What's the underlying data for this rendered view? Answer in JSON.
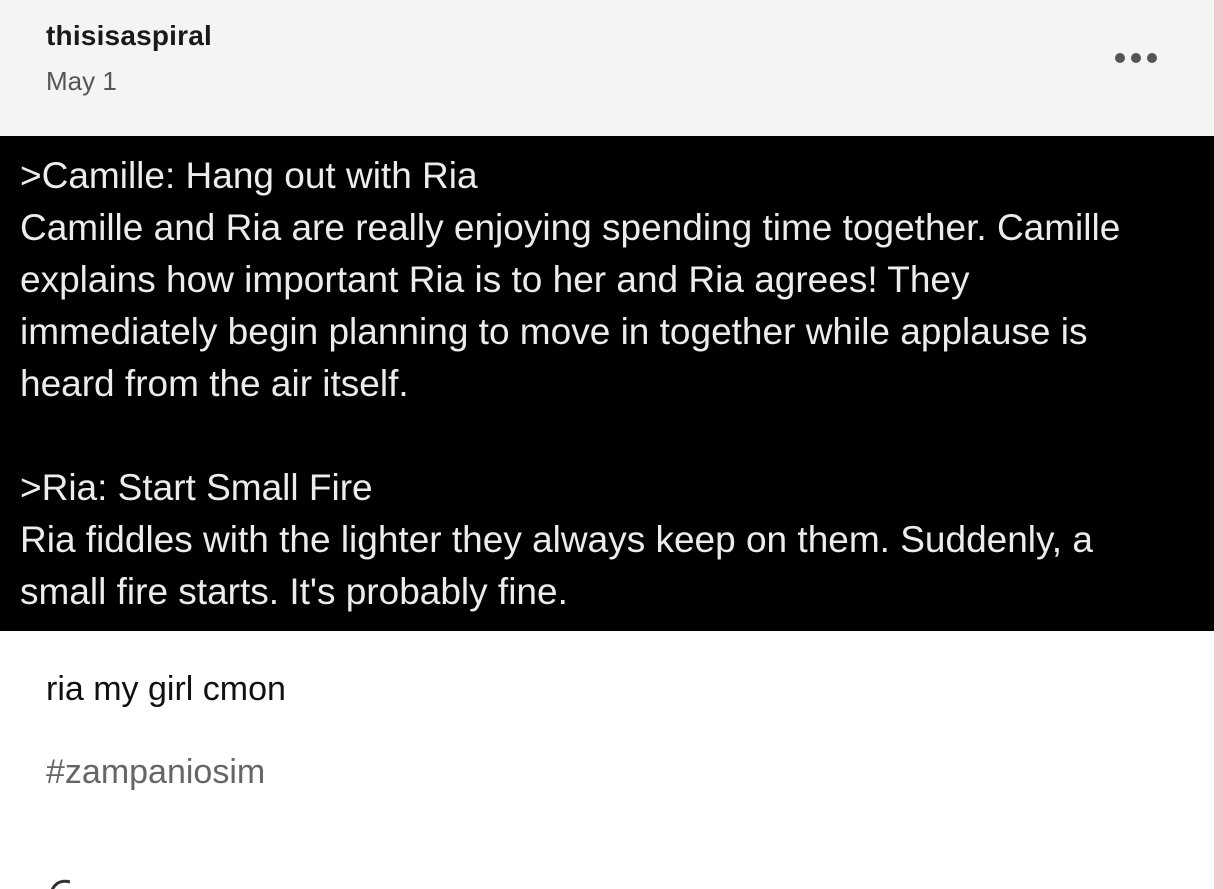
{
  "post": {
    "username": "thisisaspiral",
    "date": "May 1",
    "more_icon": "ellipsis-icon",
    "image_text": {
      "block1_title": ">Camille: Hang out with Ria",
      "block1_lines": [
        "Camille and Ria are really enjoying spending time together. Camille",
        "explains how important Ria is to her and Ria agrees! They",
        "immediately begin planning to move in together while applause is",
        "heard from the air itself."
      ],
      "block2_title": ">Ria: Start Small Fire",
      "block2_lines": [
        "Ria fiddles with the lighter they always keep on them. Suddenly, a",
        "small fire starts. It's probably fine."
      ]
    },
    "caption": "ria my girl cmon",
    "tags": [
      "#zampaniosim"
    ]
  },
  "colors": {
    "header_bg": "#f4f4f4",
    "image_bg": "#000000",
    "image_text": "#ececec",
    "tag_text": "#666666",
    "side_accent": "#f2c9cc"
  }
}
